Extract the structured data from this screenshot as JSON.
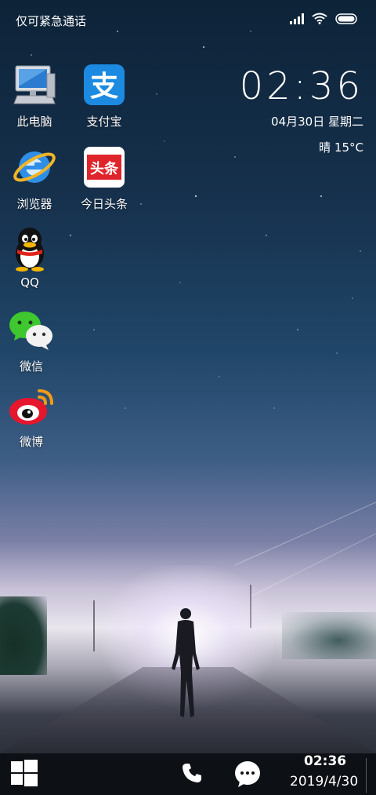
{
  "status_bar": {
    "carrier_text": "仅可紧急通话",
    "icons": [
      "signal-icon",
      "wifi-icon",
      "battery-icon"
    ]
  },
  "clock_widget": {
    "time": "02:36",
    "date": "04月30日 星期二",
    "weather": "晴 15°C"
  },
  "apps": [
    {
      "label": "此电脑",
      "icon": "computer-icon"
    },
    {
      "label": "支付宝",
      "icon": "alipay-icon"
    },
    {
      "label": "浏览器",
      "icon": "ie-browser-icon"
    },
    {
      "label": "今日头条",
      "icon": "toutiao-icon"
    },
    {
      "label": "QQ",
      "icon": "qq-penguin-icon"
    },
    {
      "label": "微信",
      "icon": "wechat-icon"
    },
    {
      "label": "微博",
      "icon": "weibo-icon"
    }
  ],
  "taskbar": {
    "time": "02:36",
    "date": "2019/4/30",
    "icons": [
      "windows-start-icon",
      "phone-icon",
      "message-icon"
    ]
  },
  "colors": {
    "alipay": "#1c8ae0",
    "toutiao": "#e0242b",
    "taskbar": "#0d1014"
  }
}
